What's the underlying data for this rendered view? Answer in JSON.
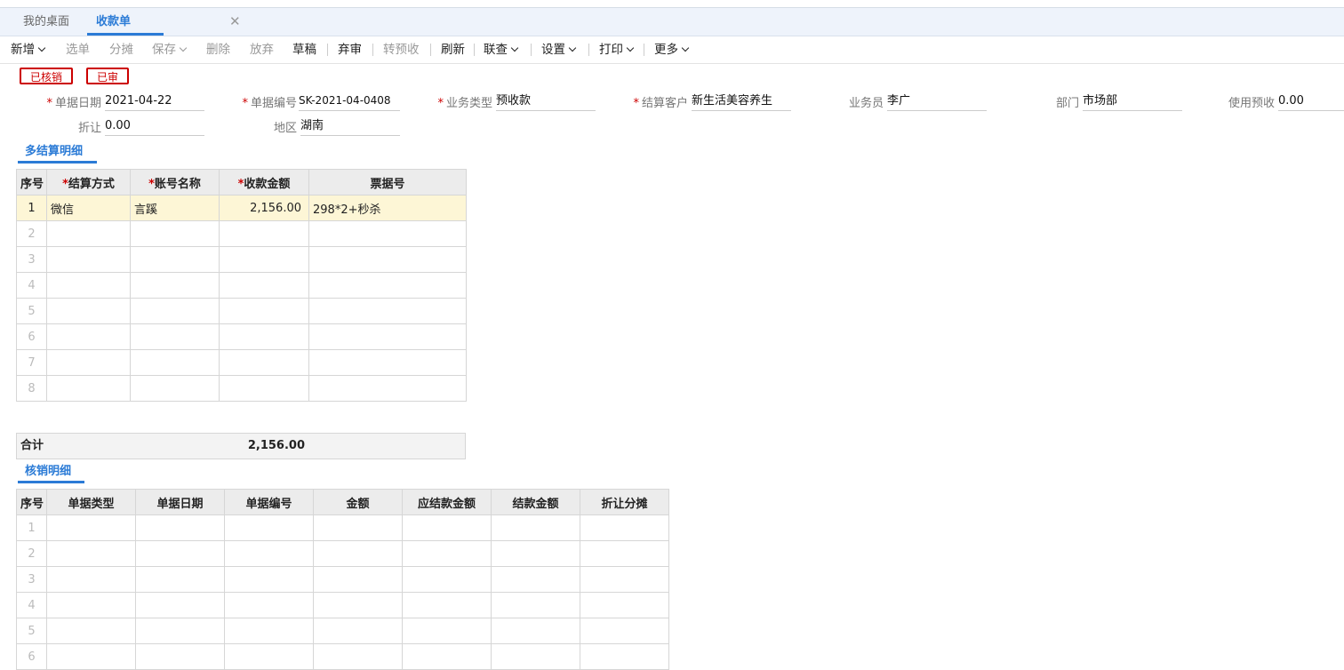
{
  "tabs": {
    "home": "我的桌面",
    "active": "收款单",
    "close_glyph": "✕"
  },
  "toolbar": {
    "new": "新增",
    "select": "选单",
    "allocate": "分摊",
    "save": "保存",
    "delete": "删除",
    "abandon": "放弃",
    "draft": "草稿",
    "unaudit": "弃审",
    "to_prereceipt": "转预收",
    "refresh": "刷新",
    "linked_query": "联查",
    "settings": "设置",
    "print": "打印",
    "more": "更多"
  },
  "badges": {
    "written_off": "已核销",
    "audited": "已审"
  },
  "fields": {
    "doc_date": {
      "label": "单据日期",
      "value": "2021-04-22"
    },
    "doc_no": {
      "label": "单据编号",
      "value": "SK-2021-04-0408"
    },
    "biz_type": {
      "label": "业务类型",
      "value": "预收款"
    },
    "customer": {
      "label": "结算客户",
      "value": "新生活美容养生"
    },
    "salesman": {
      "label": "业务员",
      "value": "李广"
    },
    "dept": {
      "label": "部门",
      "value": "市场部"
    },
    "use_prereceipt": {
      "label": "使用预收",
      "value": "0.00"
    },
    "discount": {
      "label": "折让",
      "value": "0.00"
    },
    "region": {
      "label": "地区",
      "value": "湖南"
    }
  },
  "settlement": {
    "title": "多结算明细",
    "columns": {
      "idx": "序号",
      "method": "结算方式",
      "account": "账号名称",
      "amount": "收款金额",
      "ticket": "票据号"
    },
    "rows": [
      {
        "idx": "1",
        "method": "微信",
        "account": "言蹊",
        "amount": "2,156.00",
        "ticket": "298*2+秒杀"
      },
      {
        "idx": "2",
        "method": "",
        "account": "",
        "amount": "",
        "ticket": ""
      },
      {
        "idx": "3",
        "method": "",
        "account": "",
        "amount": "",
        "ticket": ""
      },
      {
        "idx": "4",
        "method": "",
        "account": "",
        "amount": "",
        "ticket": ""
      },
      {
        "idx": "5",
        "method": "",
        "account": "",
        "amount": "",
        "ticket": ""
      },
      {
        "idx": "6",
        "method": "",
        "account": "",
        "amount": "",
        "ticket": ""
      },
      {
        "idx": "7",
        "method": "",
        "account": "",
        "amount": "",
        "ticket": ""
      },
      {
        "idx": "8",
        "method": "",
        "account": "",
        "amount": "",
        "ticket": ""
      }
    ],
    "total_label": "合计",
    "total_value": "2,156.00"
  },
  "writeoff": {
    "title": "核销明细",
    "columns": {
      "idx": "序号",
      "doc_type": "单据类型",
      "doc_date": "单据日期",
      "doc_no": "单据编号",
      "amount": "金额",
      "due": "应结款金额",
      "settled": "结款金额",
      "discount": "折让分摊"
    },
    "rows": [
      {
        "idx": "1"
      },
      {
        "idx": "2"
      },
      {
        "idx": "3"
      },
      {
        "idx": "4"
      },
      {
        "idx": "5"
      },
      {
        "idx": "6"
      }
    ]
  },
  "colors": {
    "accent": "#2b7bd6",
    "required": "#cc0000",
    "selected_row": "#fdf6d6"
  }
}
